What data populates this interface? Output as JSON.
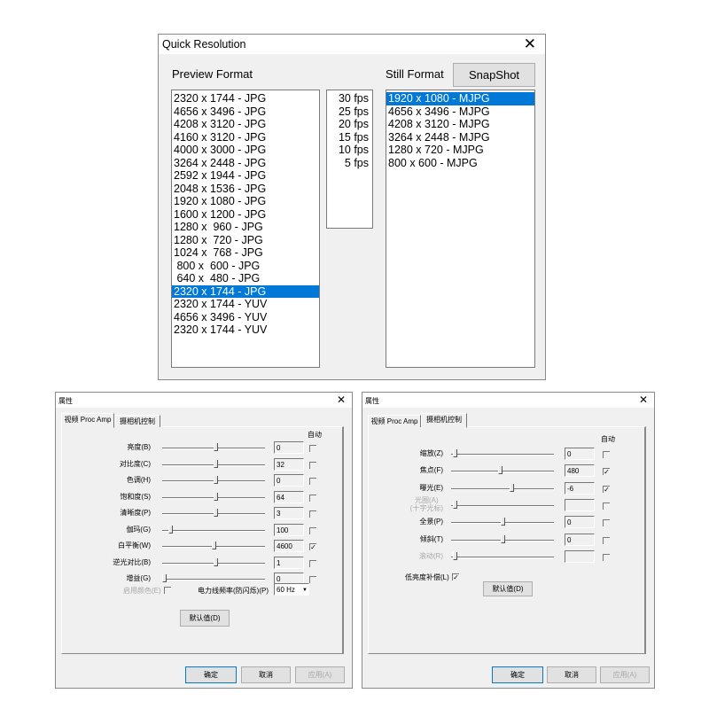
{
  "quick": {
    "title": "Quick Resolution",
    "preview_label": "Preview Format",
    "still_label": "Still Format",
    "snapshot": "SnapShot",
    "preview_items": [
      "2320 x 1744 - JPG",
      "4656 x 3496 - JPG",
      "4208 x 3120 - JPG",
      "4160 x 3120 - JPG",
      "4000 x 3000 - JPG",
      "3264 x 2448 - JPG",
      "2592 x 1944 - JPG",
      "2048 x 1536 - JPG",
      "1920 x 1080 - JPG",
      "1600 x 1200 - JPG",
      "1280 x  960 - JPG",
      "1280 x  720 - JPG",
      "1024 x  768 - JPG",
      " 800 x  600 - JPG",
      " 640 x  480 - JPG",
      "2320 x 1744 - JPG",
      "2320 x 1744 - YUV",
      "4656 x 3496 - YUV",
      "2320 x 1744 - YUV"
    ],
    "preview_selected": 15,
    "fps_items": [
      "30 fps",
      "25 fps",
      "20 fps",
      "15 fps",
      "10 fps",
      "5 fps"
    ],
    "still_items": [
      "1920 x 1080 - MJPG",
      "4656 x 3496 - MJPG",
      "4208 x 3120 - MJPG",
      "3264 x 2448 - MJPG",
      "1280 x 720 - MJPG",
      "800 x 600 - MJPG"
    ],
    "still_selected": 0
  },
  "left": {
    "title": "属性",
    "tabs": [
      "视频 Proc Amp",
      "摄相机控制"
    ],
    "active_tab": 0,
    "auto_label": "自动",
    "rows": [
      {
        "label": "亮度(B)",
        "value": "0",
        "level": 0.52,
        "auto": false
      },
      {
        "label": "对比度(C)",
        "value": "32",
        "level": 0.52,
        "auto": false
      },
      {
        "label": "色调(H)",
        "value": "0",
        "level": 0.52,
        "auto": false
      },
      {
        "label": "饱和度(S)",
        "value": "64",
        "level": 0.52,
        "auto": false
      },
      {
        "label": "清晰度(P)",
        "value": "3",
        "level": 0.52,
        "auto": false
      },
      {
        "label": "伽玛(G)",
        "value": "100",
        "level": 0.06,
        "auto": false
      },
      {
        "label": "白平衡(W)",
        "value": "4600",
        "level": 0.5,
        "auto": true
      },
      {
        "label": "逆光对比(B)",
        "value": "1",
        "level": 0.52,
        "auto": false
      },
      {
        "label": "增益(G)",
        "value": "0",
        "level": 0.0,
        "auto": false
      }
    ],
    "enable_color": "启用颜色(E)",
    "powerline_label": "电力线频率(防闪烁)(P)",
    "powerline_value": "60 Hz",
    "default_btn": "默认值(D)",
    "ok": "确定",
    "cancel": "取消",
    "apply": "应用(A)"
  },
  "right": {
    "title": "属性",
    "tabs": [
      "视频 Proc Amp",
      "摄相机控制"
    ],
    "active_tab": 1,
    "auto_label": "自动",
    "rows": [
      {
        "label": "缩放(Z)",
        "value": "0",
        "level": 0.02,
        "auto": false,
        "disabled": false
      },
      {
        "label": "焦点(F)",
        "value": "480",
        "level": 0.47,
        "auto": true,
        "disabled": false
      },
      {
        "label": "曝光(E)",
        "value": "-6",
        "level": 0.59,
        "auto": true,
        "disabled": false
      },
      {
        "label": "光圈(A)",
        "label2": "(十字光标)",
        "value": "",
        "level": 0.02,
        "auto": false,
        "disabled": true
      },
      {
        "label": "全景(P)",
        "value": "0",
        "level": 0.5,
        "auto": false,
        "disabled": false
      },
      {
        "label": "倾斜(T)",
        "value": "0",
        "level": 0.5,
        "auto": false,
        "disabled": false
      },
      {
        "label": "滚动(R)",
        "value": "",
        "level": 0.02,
        "auto": false,
        "disabled": true
      }
    ],
    "low_light": "低亮度补偿(L)",
    "low_light_checked": true,
    "default_btn": "默认值(D)",
    "ok": "确定",
    "cancel": "取消",
    "apply": "应用(A)"
  }
}
